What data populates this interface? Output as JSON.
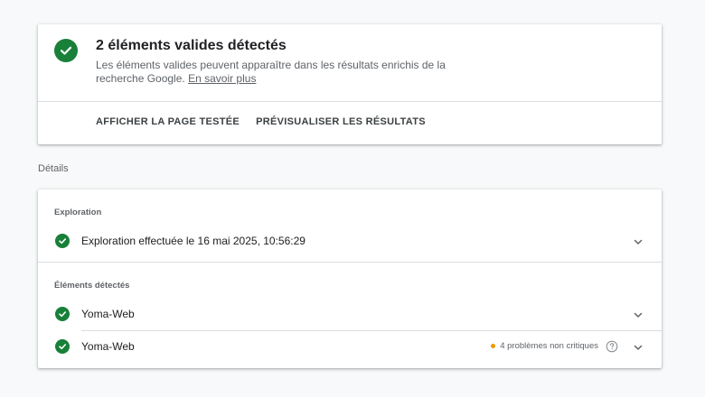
{
  "summary": {
    "title": "2 éléments valides détectés",
    "description": "Les éléments valides peuvent apparaître dans les résultats enrichis de la recherche Google.",
    "link": "En savoir plus",
    "actions": [
      "AFFICHER LA PAGE TESTÉE",
      "PRÉVISUALISER LES RÉSULTATS"
    ]
  },
  "details": {
    "heading": "Détails",
    "exploration": {
      "label": "Exploration",
      "status": "Exploration effectuée le 16 mai 2025, 10:56:29"
    },
    "detected": {
      "label": "Éléments détectés",
      "items": [
        {
          "name": "Yoma-Web",
          "warning": ""
        },
        {
          "name": "Yoma-Web",
          "warning": "4 problèmes non critiques"
        }
      ]
    }
  },
  "colors": {
    "success": "#188038",
    "warning": "#f29900",
    "background": "#f8f9fa"
  },
  "icons": {
    "check": "check-icon",
    "chevron": "chevron-down-icon",
    "help": "help-icon"
  }
}
